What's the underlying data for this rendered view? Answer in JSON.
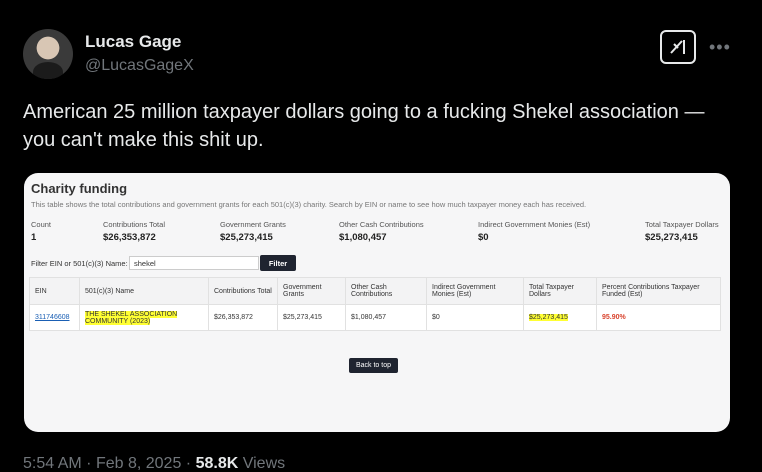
{
  "author": {
    "name": "Lucas Gage",
    "handle": "@LucasGageX"
  },
  "tweet": {
    "text": "American 25 million taxpayer dollars going to a fucking Shekel association — you can't make this shit up."
  },
  "icons": {
    "grok": "grok-icon",
    "more": "more-options-icon"
  },
  "card": {
    "title": "Charity funding",
    "description": "This table shows the total contributions and government grants for each 501(c)(3) charity. Search by EIN or name to see how much taxpayer money each has received.",
    "stats": [
      {
        "label": "Count",
        "value": "1"
      },
      {
        "label": "Contributions Total",
        "value": "$26,353,872"
      },
      {
        "label": "Government Grants",
        "value": "$25,273,415"
      },
      {
        "label": "Other Cash Contributions",
        "value": "$1,080,457"
      },
      {
        "label": "Indirect Government Monies (Est)",
        "value": "$0"
      },
      {
        "label": "Total Taxpayer Dollars",
        "value": "$25,273,415"
      }
    ],
    "filter": {
      "label": "Filter EIN or 501(c)(3) Name:",
      "value": "shekel",
      "button": "Filter"
    },
    "table": {
      "headers": [
        "EIN",
        "501(c)(3) Name",
        "Contributions Total",
        "Government Grants",
        "Other Cash Contributions",
        "Indirect Government Monies (Est)",
        "Total Taxpayer Dollars",
        "Percent Contributions Taxpayer Funded (Est)"
      ],
      "rows": [
        [
          "311746608",
          "THE SHEKEL ASSOCIATION COMMUNITY (2023)",
          "$26,353,872",
          "$25,273,415",
          "$1,080,457",
          "$0",
          "$25,273,415",
          "95.90%"
        ]
      ]
    },
    "back_to_top": "Back to top"
  },
  "meta": {
    "time": "5:54 AM",
    "sep": "·",
    "date": "Feb 8, 2025",
    "views_count": "58.8K",
    "views_label": "Views"
  }
}
